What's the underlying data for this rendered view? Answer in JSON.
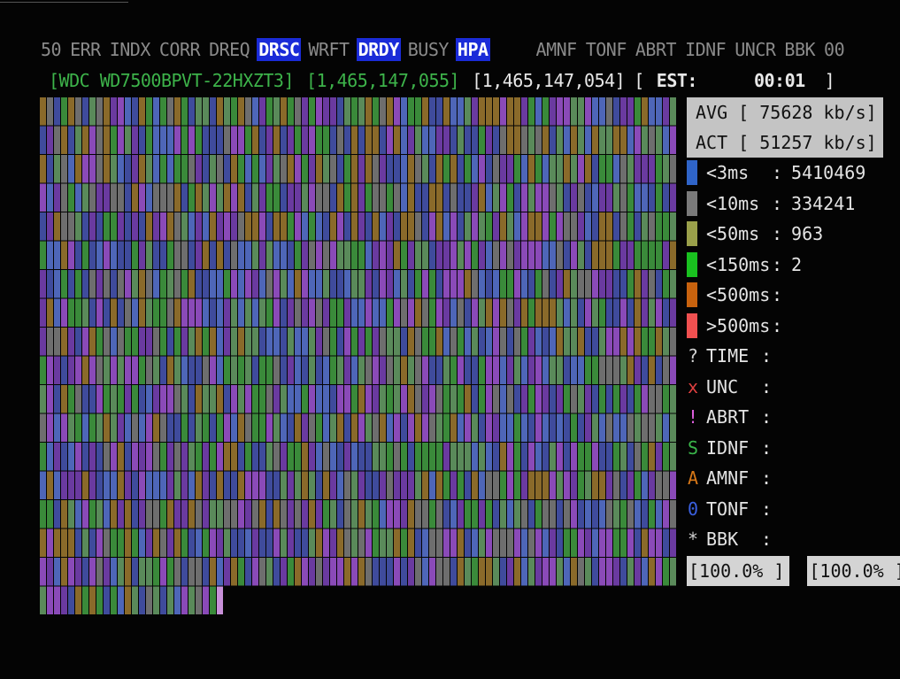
{
  "status_flags": [
    {
      "label": "50",
      "active": false
    },
    {
      "label": "ERR",
      "active": false
    },
    {
      "label": "INDX",
      "active": false
    },
    {
      "label": "CORR",
      "active": false
    },
    {
      "label": "DREQ",
      "active": false
    },
    {
      "label": "DRSC",
      "active": true
    },
    {
      "label": "WRFT",
      "active": false
    },
    {
      "label": "DRDY",
      "active": true
    },
    {
      "label": "BUSY",
      "active": false
    },
    {
      "label": "HPA",
      "active": true
    },
    {
      "label": "AMNF",
      "active": false,
      "gap": true
    },
    {
      "label": "TONF",
      "active": false
    },
    {
      "label": "ABRT",
      "active": false
    },
    {
      "label": "IDNF",
      "active": false
    },
    {
      "label": "UNCR",
      "active": false
    },
    {
      "label": "BBK",
      "active": false
    },
    {
      "label": "00",
      "active": false
    }
  ],
  "drive": {
    "model": "[WDC WD7500BPVT-22HXZT3]",
    "max_lba": "[1,465,147,055]",
    "current_lba": "[1,465,147,054]",
    "est_open": "[",
    "est_label": "EST:",
    "est_time": "00:01",
    "est_close": "]"
  },
  "speed": {
    "avg": "AVG [ 75628 kb/s]",
    "act": "ACT [ 51257 kb/s]"
  },
  "latency": [
    {
      "label": "<3ms",
      "sep": ":",
      "count": "5410469",
      "color": "#2f64c8"
    },
    {
      "label": "<10ms",
      "sep": ":",
      "count": "334241",
      "color": "#7a7a7a"
    },
    {
      "label": "<50ms",
      "sep": ":",
      "count": "963",
      "color": "#9aa04a"
    },
    {
      "label": "<150ms",
      "sep": ":",
      "count": "2",
      "color": "#19c11f"
    },
    {
      "label": "<500ms",
      "sep": ":",
      "count": "",
      "color": "#c8620e"
    },
    {
      "label": ">500ms",
      "sep": ":",
      "count": "",
      "color": "#f05050"
    }
  ],
  "errors": [
    {
      "symbol": "?",
      "label": "TIME",
      "sep": ":",
      "color": "#cfcfcf"
    },
    {
      "symbol": "x",
      "label": "UNC",
      "sep": ":",
      "color": "#e04040"
    },
    {
      "symbol": "!",
      "label": "ABRT",
      "sep": ":",
      "color": "#e060e0"
    },
    {
      "symbol": "S",
      "label": "IDNF",
      "sep": ":",
      "color": "#3ab54a"
    },
    {
      "symbol": "A",
      "label": "AMNF",
      "sep": ":",
      "color": "#d87818"
    },
    {
      "symbol": "0",
      "label": "TONF",
      "sep": ":",
      "color": "#3a60e0"
    },
    {
      "symbol": "*",
      "label": "BBK",
      "sep": ":",
      "color": "#cfcfcf"
    }
  ],
  "progress": {
    "left": "[100.0% ]",
    "right": "[100.0% ]"
  },
  "scan_grid": {
    "palette": [
      "#3f4b9c",
      "#3a8a3a",
      "#6a3aa0",
      "#8a6a2a",
      "#6e6e6e",
      "#4e66b8",
      "#8a4ab8",
      "#5a8a5a"
    ]
  }
}
